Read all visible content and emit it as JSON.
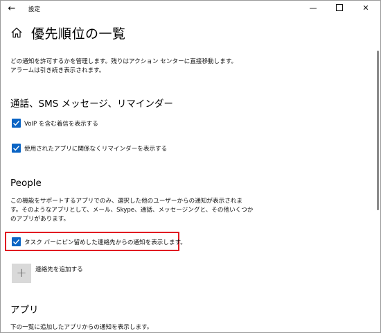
{
  "window": {
    "title": "設定",
    "back_glyph": "←",
    "minimize_glyph": "—",
    "close_glyph": "✕"
  },
  "header": {
    "title": "優先順位の一覧"
  },
  "intro": {
    "line1": "どの通知を許可するかを管理します。残りはアクション センターに直接移動します。",
    "line2": "アラームは引き続き表示されます。"
  },
  "calls_section": {
    "heading": "通話、SMS メッセージ、リマインダー",
    "options": [
      {
        "label": "VoIP を含む着信を表示する",
        "checked": true
      },
      {
        "label": "使用されたアプリに関係なくリマインダーを表示する",
        "checked": true
      }
    ]
  },
  "people_section": {
    "heading": "People",
    "desc1": "この機能をサポートするアプリでのみ、選択した他のユーザーからの通知が表示されま",
    "desc2": "す。そのようなアプリとして、メール、Skype、通話、メッセージングと、その他いくつか",
    "desc3": "のアプリがあります。",
    "pinned_option": {
      "label": "タスク バーにピン留めした連絡先からの通知を表示します。",
      "checked": true
    },
    "add_contact_label": "連絡先を追加する",
    "add_glyph": "+"
  },
  "apps_section": {
    "heading": "アプリ",
    "desc": "下の一覧に追加したアプリからの通知を表示します。"
  },
  "colors": {
    "accent": "#0a64c4",
    "highlight": "#e11b22"
  }
}
